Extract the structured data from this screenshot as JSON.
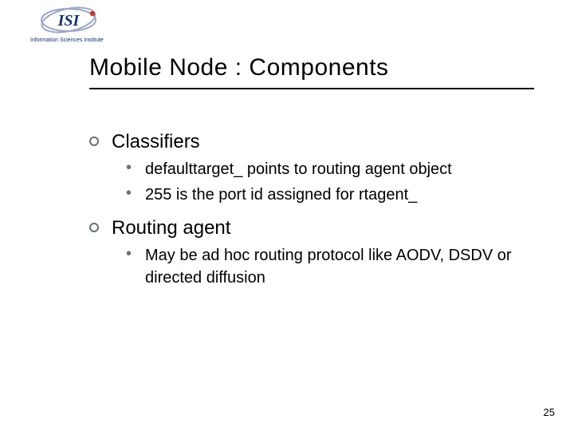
{
  "logo": {
    "primary": "ISI",
    "subtitle": "Information Sciences Institute"
  },
  "title": "Mobile Node : Components",
  "sections": {
    "classifiers": {
      "label": "Classifiers",
      "items": {
        "i0": "defaulttarget_ points to routing agent object",
        "i1": "255 is the port id assigned for rtagent_"
      }
    },
    "routing": {
      "label": "Routing agent",
      "items": {
        "i0": "May be ad hoc routing protocol like AODV, DSDV or directed diffusion"
      }
    }
  },
  "page_number": "25"
}
